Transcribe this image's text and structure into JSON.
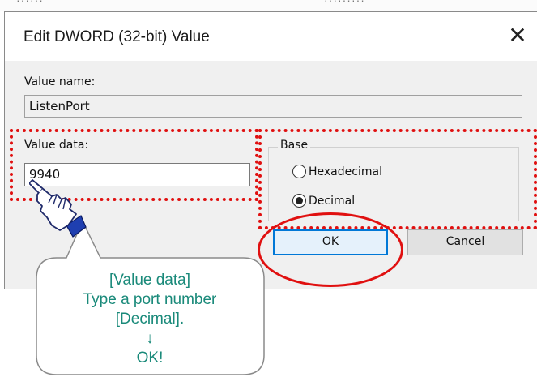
{
  "background": {
    "ghost_left": "······",
    "ghost_right": "·········"
  },
  "dialog": {
    "title": "Edit DWORD (32-bit) Value",
    "close_glyph": "✕",
    "value_name_label": "Value name:",
    "value_name": "ListenPort",
    "value_data_label": "Value data:",
    "value_data": "9940",
    "base": {
      "title": "Base",
      "options": [
        {
          "label": "Hexadecimal",
          "selected": false
        },
        {
          "label": "Decimal",
          "selected": true
        }
      ]
    },
    "ok_label": "OK",
    "cancel_label": "Cancel"
  },
  "annotation": {
    "line1": "[Value data]",
    "line2": "Type a port number",
    "line3": "[Decimal].",
    "arrow": "↓",
    "line4": "OK!"
  },
  "colors": {
    "highlight": "#e01010",
    "callout_text": "#1a8a7a",
    "hand_cuff": "#1f3fb0",
    "default_button_border": "#0078d7"
  },
  "icons": {
    "pointer": "pointing-hand-icon",
    "close": "close-icon"
  }
}
